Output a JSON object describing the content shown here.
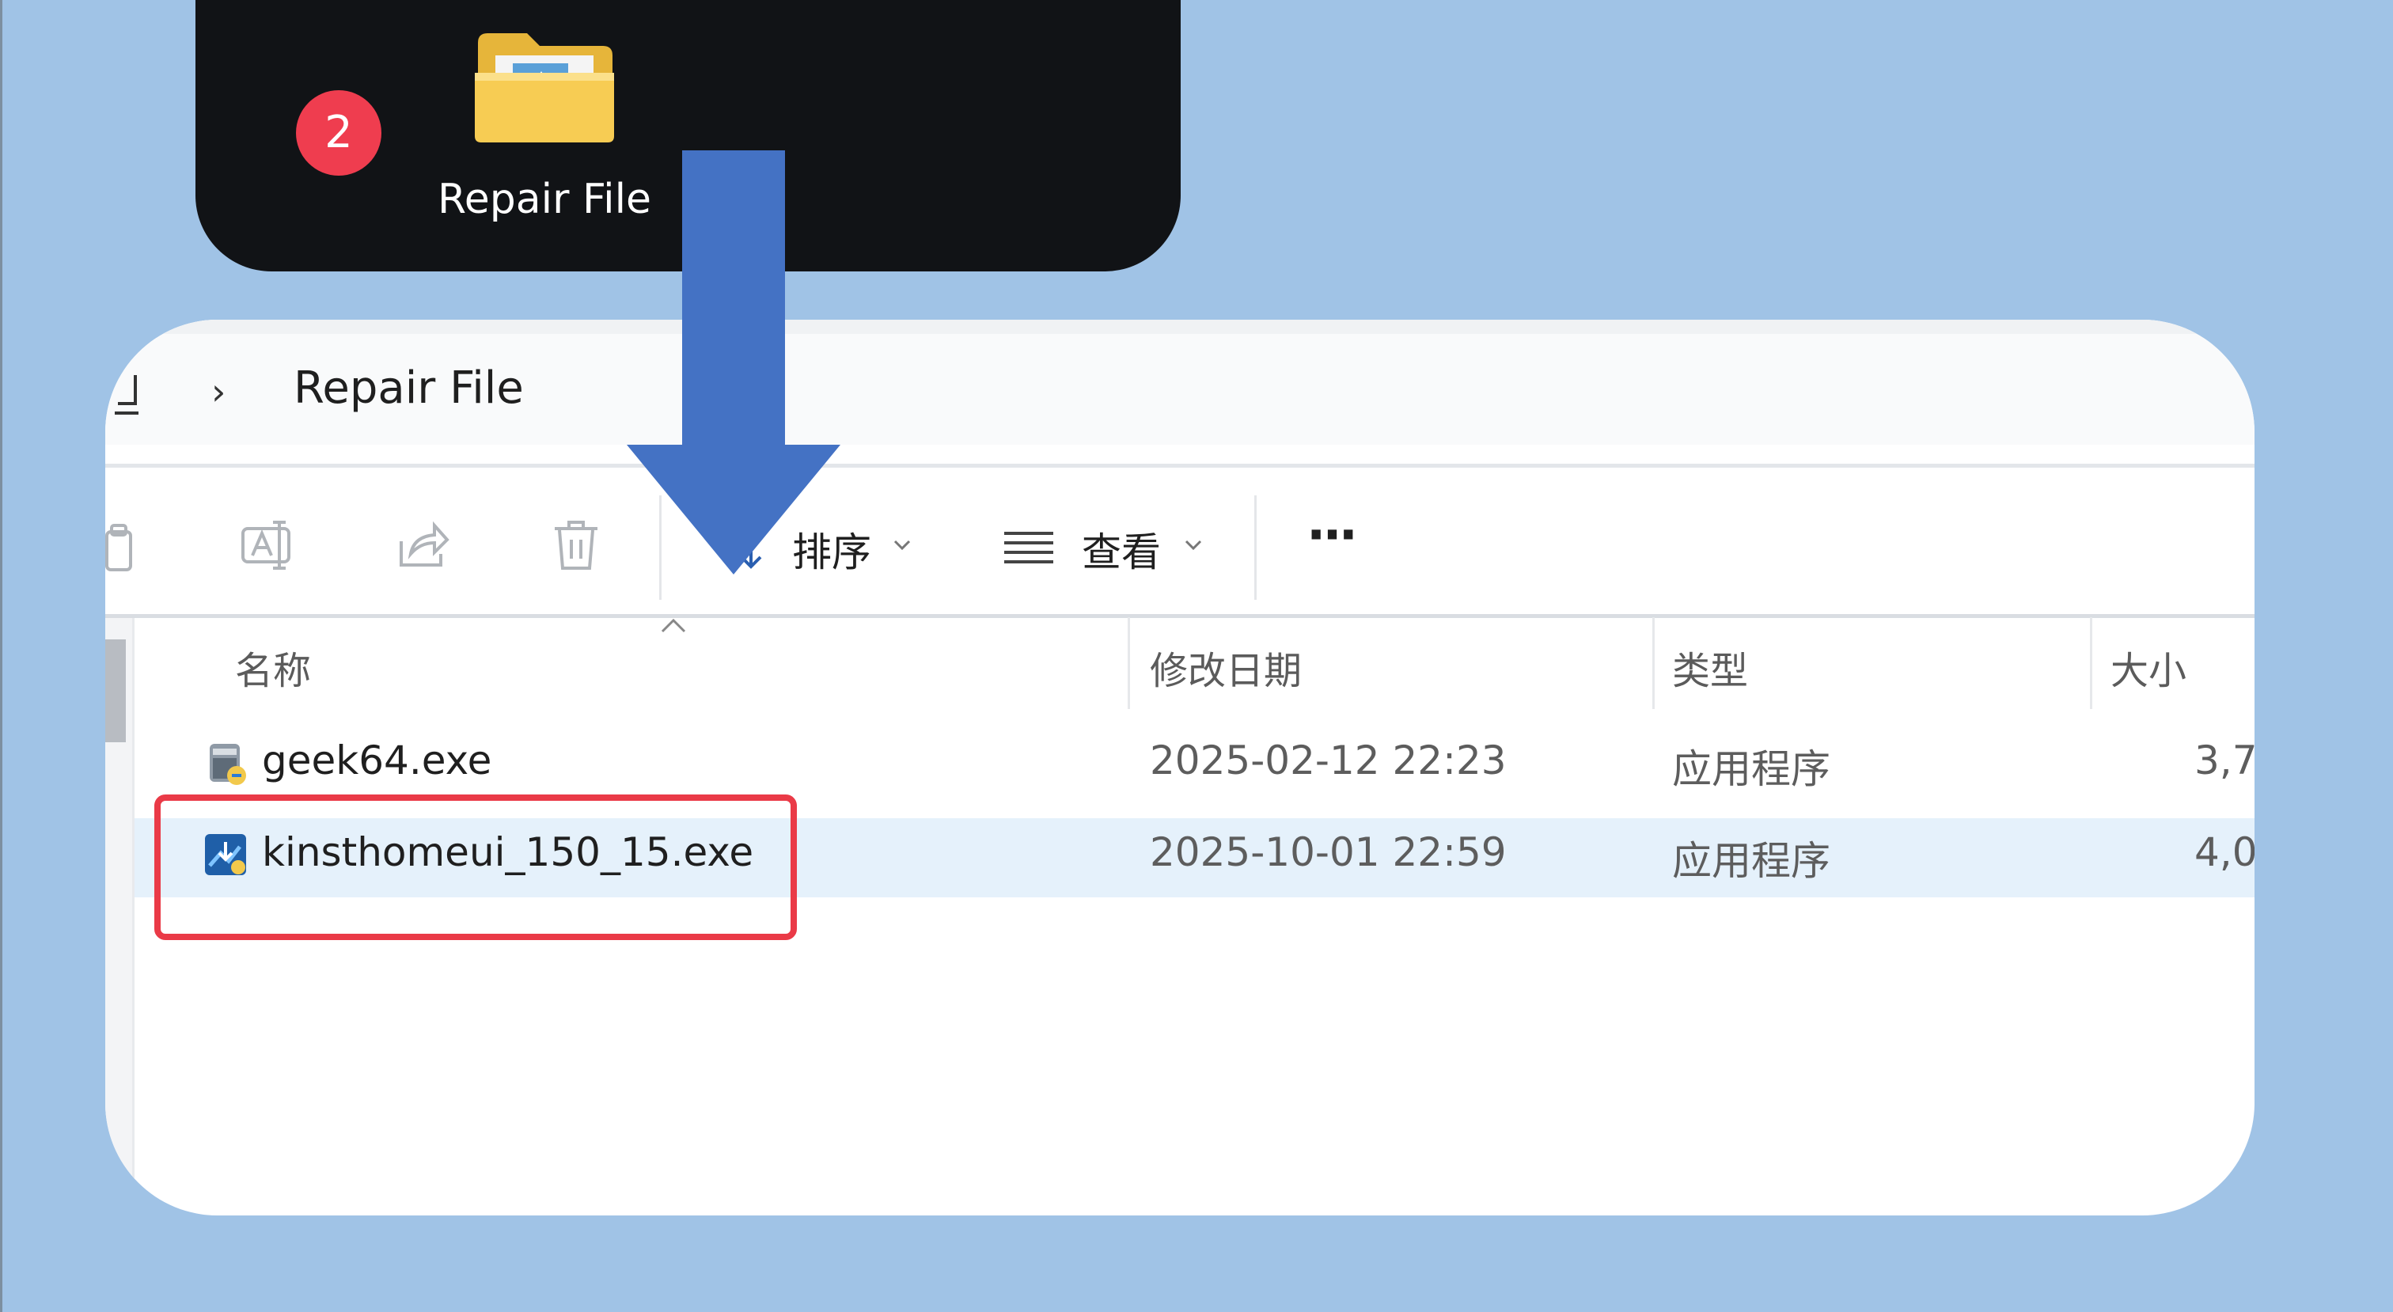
{
  "desktop": {
    "step_number": "2",
    "folder_label": "Repair File"
  },
  "address_bar": {
    "separator": "›",
    "current_folder": "Repair File"
  },
  "toolbar": {
    "sort_label": "排序",
    "view_label": "查看",
    "more_label": "···"
  },
  "columns": {
    "name": "名称",
    "modified": "修改日期",
    "type": "类型",
    "size": "大小"
  },
  "files": [
    {
      "name": "geek64.exe",
      "modified": "2025-02-12 22:23",
      "type": "应用程序",
      "size": "3,7"
    },
    {
      "name": "kinsthomeui_150_15.exe",
      "modified": "2025-10-01 22:59",
      "type": "应用程序",
      "size": "4,0"
    }
  ],
  "colors": {
    "background": "#a0c3e6",
    "arrow": "#4472c4",
    "highlight": "#ea3a47",
    "selected_row": "#e5f1fb",
    "badge": "#ef3d4f"
  }
}
